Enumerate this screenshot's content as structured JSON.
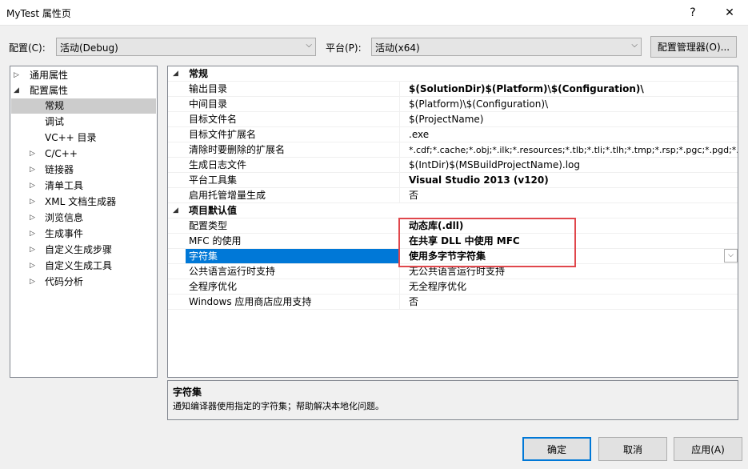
{
  "window": {
    "title": "MyTest 属性页",
    "help": "?",
    "close": "✕"
  },
  "config": {
    "config_label": "配置(C):",
    "config_value": "活动(Debug)",
    "platform_label": "平台(P):",
    "platform_value": "活动(x64)",
    "manager_label": "配置管理器(O)..."
  },
  "tree": {
    "items": [
      {
        "label": "通用属性",
        "expander": "▷"
      },
      {
        "label": "配置属性",
        "expander": "◢"
      },
      {
        "label": "常规"
      },
      {
        "label": "调试"
      },
      {
        "label": "VC++ 目录"
      },
      {
        "label": "C/C++",
        "expander": "▷"
      },
      {
        "label": "链接器",
        "expander": "▷"
      },
      {
        "label": "清单工具",
        "expander": "▷"
      },
      {
        "label": "XML 文档生成器",
        "expander": "▷"
      },
      {
        "label": "浏览信息",
        "expander": "▷"
      },
      {
        "label": "生成事件",
        "expander": "▷"
      },
      {
        "label": "自定义生成步骤",
        "expander": "▷"
      },
      {
        "label": "自定义生成工具",
        "expander": "▷"
      },
      {
        "label": "代码分析",
        "expander": "▷"
      }
    ]
  },
  "grid": {
    "category1": {
      "label": "常规",
      "expander": "◢"
    },
    "rows1": [
      {
        "name": "输出目录",
        "value": "$(SolutionDir)$(Platform)\\$(Configuration)\\"
      },
      {
        "name": "中间目录",
        "value": "$(Platform)\\$(Configuration)\\"
      },
      {
        "name": "目标文件名",
        "value": "$(ProjectName)"
      },
      {
        "name": "目标文件扩展名",
        "value": ".exe"
      },
      {
        "name": "清除时要删除的扩展名",
        "value": "*.cdf;*.cache;*.obj;*.ilk;*.resources;*.tlb;*.tli;*.tlh;*.tmp;*.rsp;*.pgc;*.pgd;*.meta;*.tlog;*.manifest;*.res;*.pch;*.exp;*.idb;*.rep;*.xdc;*.pdb;*_manifest.rc;*.bsc;*.sbr;*.xml;*.metagen;*.bi"
      },
      {
        "name": "生成日志文件",
        "value": "$(IntDir)$(MSBuildProjectName).log"
      },
      {
        "name": "平台工具集",
        "value": "Visual Studio 2013 (v120)"
      },
      {
        "name": "启用托管增量生成",
        "value": "否"
      }
    ],
    "category2": {
      "label": "项目默认值",
      "expander": "◢"
    },
    "rows2": [
      {
        "name": "配置类型",
        "value": "动态库(.dll)"
      },
      {
        "name": "MFC 的使用",
        "value": "在共享 DLL 中使用 MFC"
      },
      {
        "name": "字符集",
        "value": "使用多字节字符集"
      },
      {
        "name": "公共语言运行时支持",
        "value": "无公共语言运行时支持"
      },
      {
        "name": "全程序优化",
        "value": "无全程序优化"
      },
      {
        "name": "Windows 应用商店应用支持",
        "value": "否"
      }
    ]
  },
  "description": {
    "title": "字符集",
    "text": "通知编译器使用指定的字符集；帮助解决本地化问题。"
  },
  "buttons": {
    "ok": "确定",
    "cancel": "取消",
    "apply": "应用(A)"
  },
  "colors": {
    "selection": "#0078d7",
    "annotation_box": "#e0474c"
  }
}
